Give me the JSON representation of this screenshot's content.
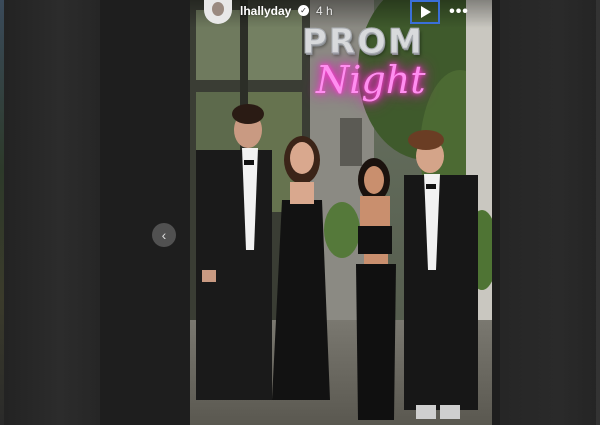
{
  "story": {
    "username": "lhallyday",
    "timestamp": "4 h",
    "verified": true,
    "sticker_line1": "PROM",
    "sticker_line2": "Night"
  },
  "controls": {
    "prev_icon": "‹",
    "more_icon": "•••",
    "play_icon": "play-icon"
  },
  "colors": {
    "neon_pink": "#ff8ef0",
    "focus_outline": "#3a6fd8",
    "backdrop": "#1e1e1e"
  }
}
